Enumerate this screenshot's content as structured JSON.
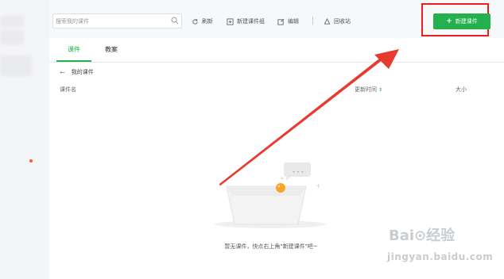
{
  "toolbar": {
    "search_placeholder": "搜索我的课件",
    "refresh_label": "刷新",
    "new_group_label": "新建课件组",
    "edit_label": "编辑",
    "recycle_label": "回收站",
    "separator": "|",
    "new_courseware_label": "新建课件"
  },
  "tabs": [
    {
      "label": "课件",
      "active": true
    },
    {
      "label": "教案",
      "active": false
    }
  ],
  "breadcrumb": {
    "back_glyph": "←",
    "label": "我的课件"
  },
  "table": {
    "columns": {
      "name": "课件名",
      "time": "更新时间",
      "time_sort": "⇕",
      "size": "大小"
    }
  },
  "empty_state": {
    "text": "暂无课件，快点右上角\"新建课件\"吧~",
    "bubble": "• • •"
  },
  "watermark": {
    "top": "Bai⊙经验",
    "bottom": "jingyan.baidu.com"
  },
  "colors": {
    "accent": "#22b14c",
    "highlight": "#ee1c1c",
    "arrow": "#e83a2e"
  }
}
